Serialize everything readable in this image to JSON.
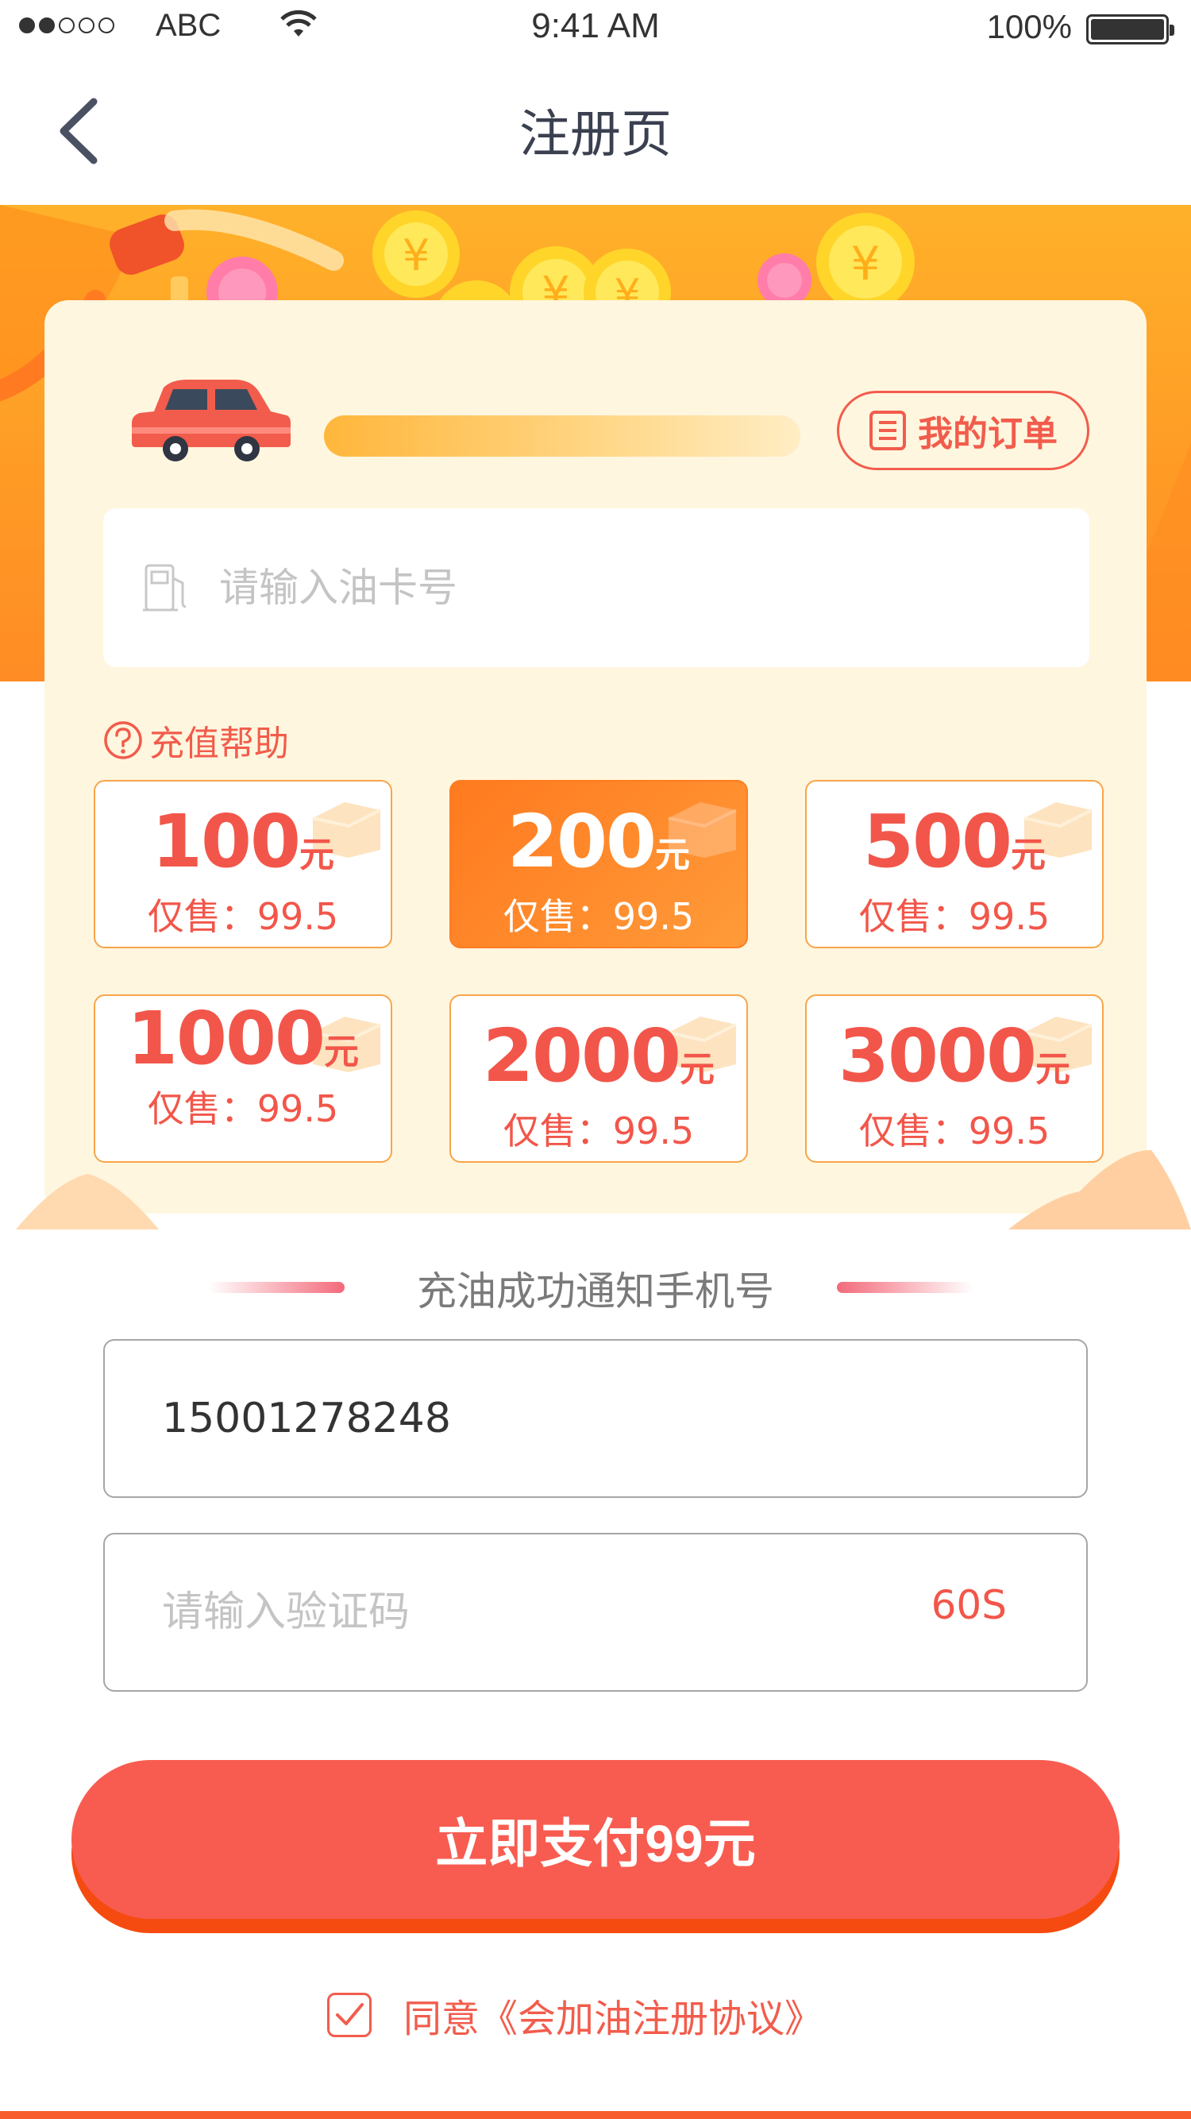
{
  "status_bar": {
    "carrier": "ABC",
    "time": "9:41 AM",
    "battery": "100%",
    "signal_bars": 2
  },
  "nav": {
    "title": "注册页"
  },
  "card": {
    "orders_label": "我的订单",
    "card_input_placeholder": "请输入油卡号",
    "help_label": "充值帮助",
    "options": [
      {
        "amount": "100",
        "unit": "元",
        "price": "仅售：99.5",
        "selected": false
      },
      {
        "amount": "200",
        "unit": "元",
        "price": "仅售：99.5",
        "selected": true
      },
      {
        "amount": "500",
        "unit": "元",
        "price": "仅售：99.5",
        "selected": false
      },
      {
        "amount": "1000",
        "unit": "元",
        "price": "仅售：99.5",
        "selected": false
      },
      {
        "amount": "2000",
        "unit": "元",
        "price": "仅售：99.5",
        "selected": false
      },
      {
        "amount": "3000",
        "unit": "元",
        "price": "仅售：99.5",
        "selected": false
      }
    ]
  },
  "phone_section": {
    "title": "充油成功通知手机号",
    "phone_value": "15001278248",
    "code_placeholder": "请输入验证码",
    "countdown": "60S"
  },
  "pay_button": {
    "label": "立即支付99元"
  },
  "agreement": {
    "text": "同意《会加油注册协议》",
    "checked": true
  },
  "colors": {
    "accent": "#f85c50",
    "orange": "#ff8c25",
    "card_bg": "#fff6df"
  }
}
